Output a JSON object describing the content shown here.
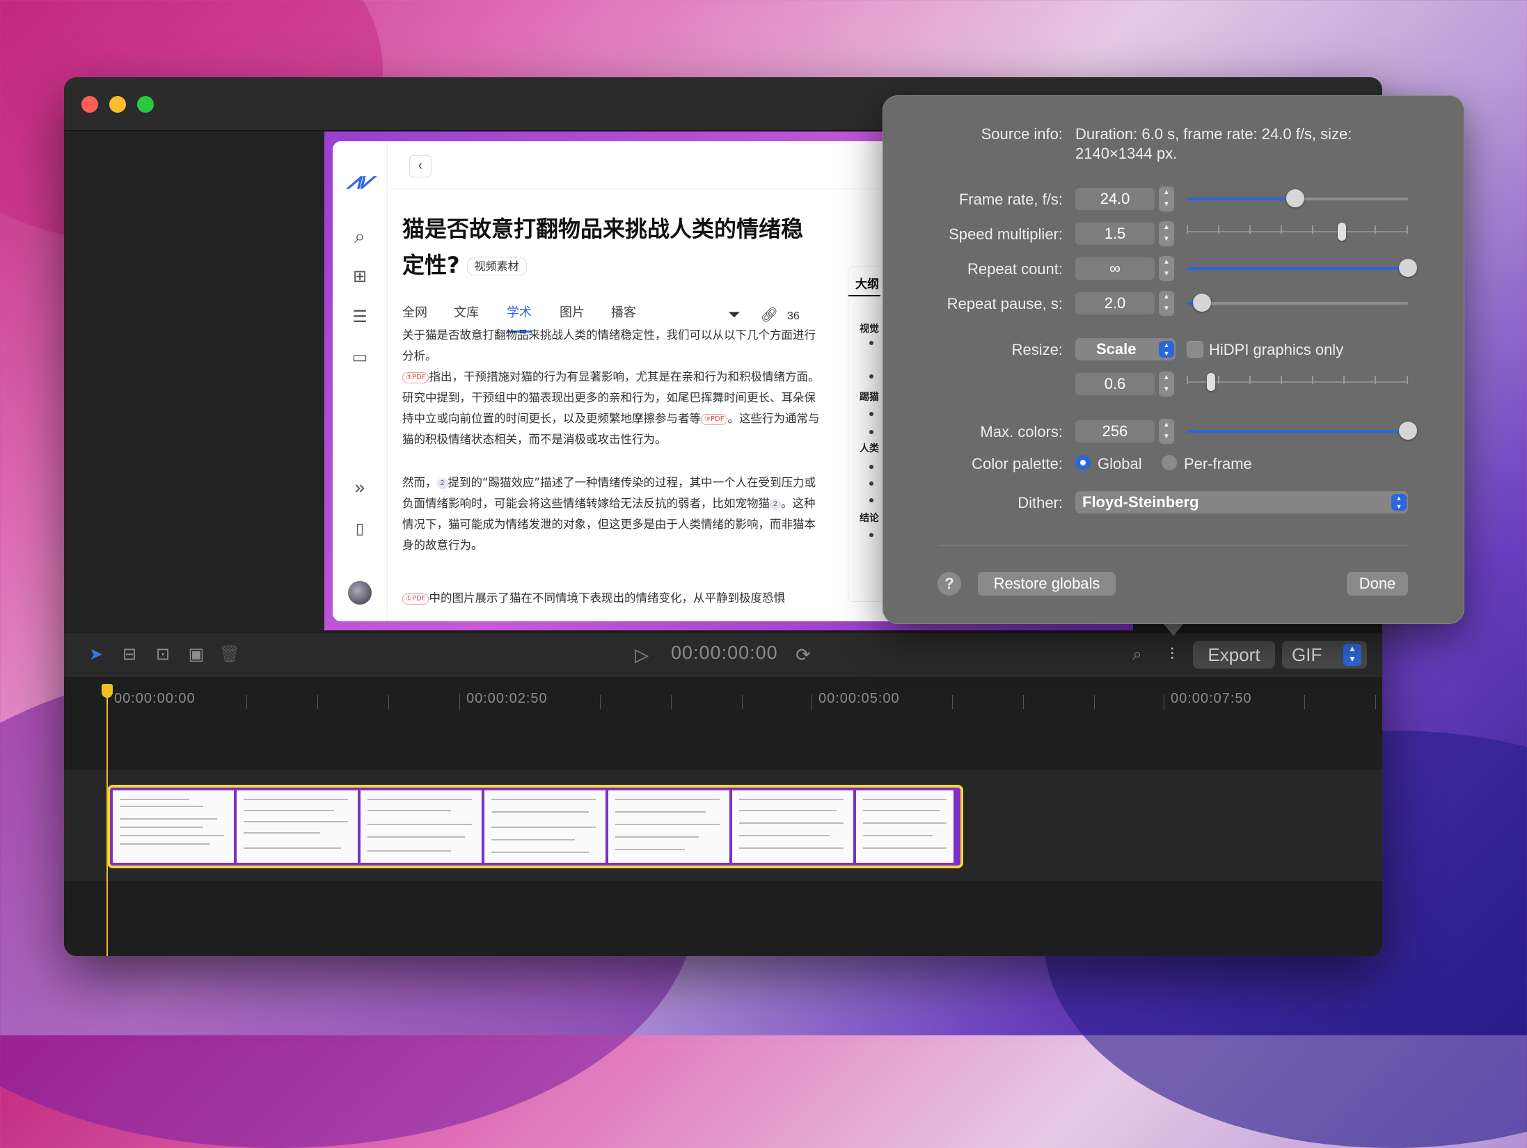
{
  "article": {
    "title": "猫是否故意打翻物品来挑战人类的情绪稳定性?",
    "tag": "视频素材",
    "tabs": [
      "全网",
      "文库",
      "学术",
      "图片",
      "播客"
    ],
    "link_count": "36",
    "outline_title": "大纲",
    "outline_items": [
      "视觉",
      "踢猫",
      "人类",
      "结论"
    ],
    "p1": "关于猫是否故意打翻物品来挑战人类的情绪稳定性，我们可以从以下几个方面进行分析。",
    "p2_cite": "③PDF",
    "p2": "指出，干预措施对猫的行为有显著影响，尤其是在亲和行为和积极情绪方面。研究中提到，干预组中的猫表现出更多的亲和行为，如尾巴挥舞时间更长、耳朵保持中立或向前位置的时间更长，以及更频繁地摩擦参与者等",
    "p2_cite2": "③PDF",
    "p2_end": "。这些行为通常与猫的积极情绪状态相关，而不是消极或攻击性行为。",
    "p3_start": "然而，",
    "p3_num": "2",
    "p3": "提到的“踢猫效应”描述了一种情绪传染的过程，其中一个人在受到压力或负面情绪影响时，可能会将这些情绪转嫁给无法反抗的弱者，比如宠物猫",
    "p3_num2": "2",
    "p3_end": "。这种情况下，猫可能成为情绪发泄的对象，但这更多是由于人类情绪的影响，而非猫本身的故意行为。",
    "p4_cite": "①PDF",
    "p4": "中的图片展示了猫在不同情境下表现出的情绪变化，从平静到极度恐惧"
  },
  "toolbar": {
    "timecode": "00:00:00:00",
    "export_label": "Export",
    "format_value": "GIF"
  },
  "timeline": {
    "labels": [
      "00:00:00:00",
      "00:00:02:50",
      "00:00:05:00",
      "00:00:07:50"
    ]
  },
  "popover": {
    "source_info_label": "Source info:",
    "source_info_value_1": "Duration: 6.0 s, frame rate: 24.0 f/s, size:",
    "source_info_value_2": "2140×1344 px.",
    "frame_rate_label": "Frame rate, f/s:",
    "frame_rate_value": "24.0",
    "frame_rate_level": 0.49,
    "speed_label": "Speed multiplier:",
    "speed_value": "1.5",
    "speed_level": 0.7,
    "repeat_count_label": "Repeat count:",
    "repeat_count_value": "∞",
    "repeat_count_level": 1.0,
    "repeat_pause_label": "Repeat pause, s:",
    "repeat_pause_value": "2.0",
    "repeat_pause_level": 0.07,
    "resize_label": "Resize:",
    "resize_mode": "Scale",
    "hidpi_label": "HiDPI graphics only",
    "resize_value": "0.6",
    "resize_level": 0.11,
    "max_colors_label": "Max. colors:",
    "max_colors_value": "256",
    "max_colors_level": 1.0,
    "palette_label": "Color palette:",
    "palette_global": "Global",
    "palette_perframe": "Per-frame",
    "dither_label": "Dither:",
    "dither_value": "Floyd-Steinberg",
    "help_label": "?",
    "restore_label": "Restore globals",
    "done_label": "Done"
  },
  "colors": {
    "accent": "#2b67db",
    "clip_border": "#f0d83a",
    "playhead": "#f0c020"
  }
}
